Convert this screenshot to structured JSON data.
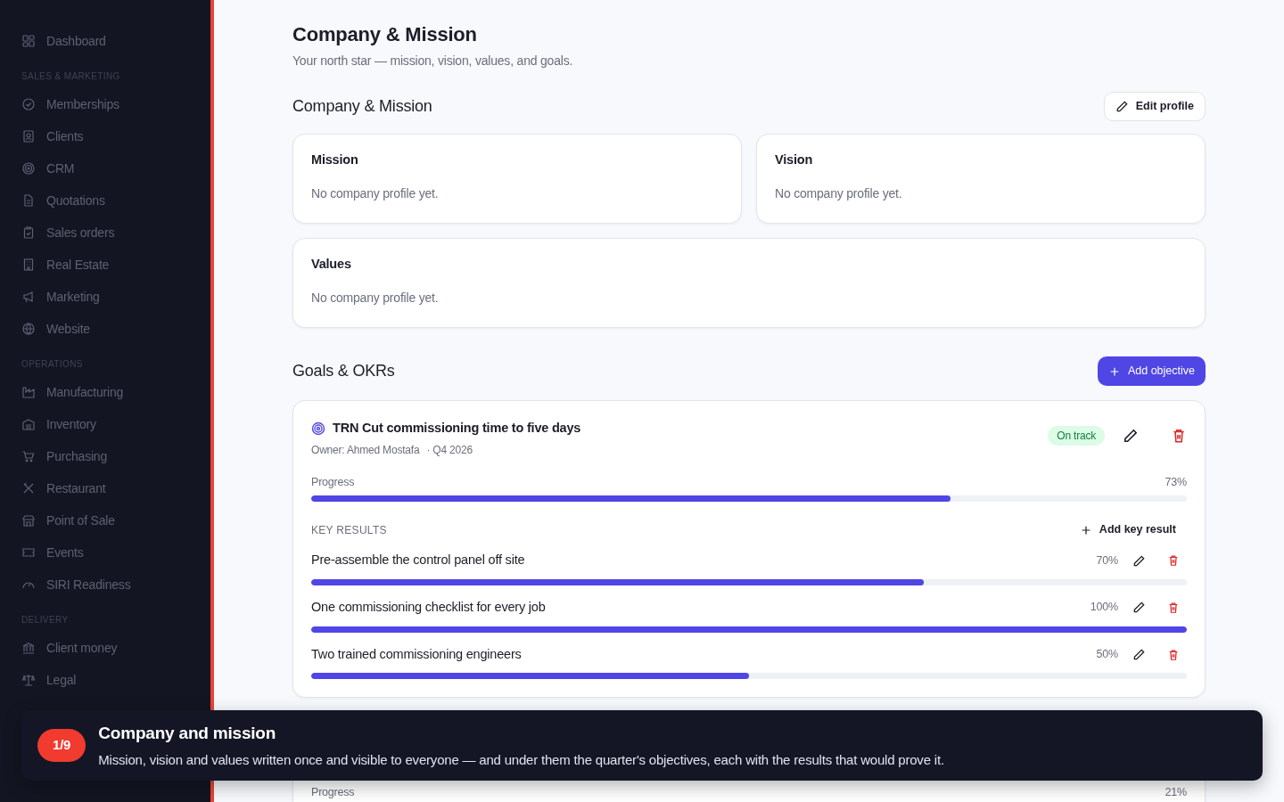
{
  "sidebar": {
    "top_items": [
      {
        "label": "Dashboard"
      }
    ],
    "sections": [
      {
        "heading": "SALES & MARKETING",
        "items": [
          {
            "label": "Memberships"
          },
          {
            "label": "Clients"
          },
          {
            "label": "CRM"
          },
          {
            "label": "Quotations"
          },
          {
            "label": "Sales orders"
          },
          {
            "label": "Real Estate"
          },
          {
            "label": "Marketing"
          },
          {
            "label": "Website"
          }
        ]
      },
      {
        "heading": "OPERATIONS",
        "items": [
          {
            "label": "Manufacturing"
          },
          {
            "label": "Inventory"
          },
          {
            "label": "Purchasing"
          },
          {
            "label": "Restaurant"
          },
          {
            "label": "Point of Sale"
          },
          {
            "label": "Events"
          },
          {
            "label": "SIRI Readiness"
          }
        ]
      },
      {
        "heading": "DELIVERY",
        "items": [
          {
            "label": "Client money"
          },
          {
            "label": "Legal"
          }
        ]
      }
    ]
  },
  "page": {
    "title": "Company & Mission",
    "subtitle": "Your north star — mission, vision, values, and goals."
  },
  "profile": {
    "heading": "Company & Mission",
    "edit_button": "Edit profile",
    "cards": [
      {
        "title": "Mission",
        "text": "No company profile yet.",
        "kind": "half"
      },
      {
        "title": "Vision",
        "text": "No company profile yet.",
        "kind": "half"
      },
      {
        "title": "Values",
        "text": "No company profile yet.",
        "kind": "full"
      }
    ]
  },
  "goals": {
    "heading": "Goals & OKRs",
    "add_button": "Add objective",
    "objectives": [
      {
        "title": "TRN Cut commissioning time to five days",
        "owner": "Owner: Ahmed Mostafa",
        "quarter": "· Q4 2026",
        "status": {
          "label": "On track",
          "kind": "on_track"
        },
        "progress_label": "Progress",
        "progress": "73%",
        "level": 0.73,
        "key_results_heading": "KEY RESULTS",
        "add_key_result": "Add key result",
        "key_results": [
          {
            "title": "Pre-assemble the control panel off site",
            "percent": "70%",
            "level": 0.7
          },
          {
            "title": "One commissioning checklist for every job",
            "percent": "100%",
            "level": 1
          },
          {
            "title": "Two trained commissioning engineers",
            "percent": "50%",
            "level": 0.5
          }
        ]
      },
      {
        "progress_label": "Progress",
        "progress": "21%"
      }
    ]
  },
  "tour": {
    "step": "1/9",
    "title": "Company and mission",
    "text": "Mission, vision and values written once and visible to everyone — and under them the quarter's objectives, each with the results that would prove it."
  }
}
